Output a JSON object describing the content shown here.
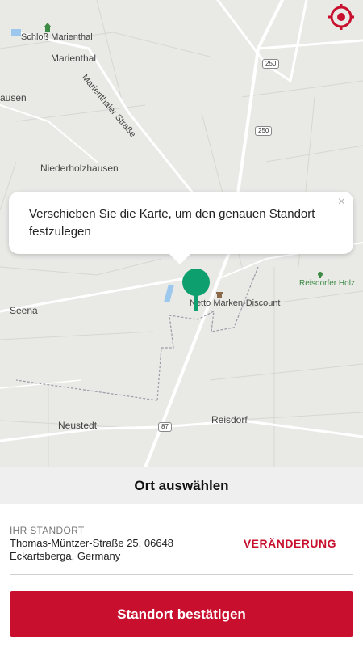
{
  "map": {
    "labels": {
      "schloss": "Schloß Marienthal",
      "marienthal": "Marienthal",
      "marienthaler_strasse": "Marienthaler Straße",
      "hausen": "ausen",
      "niederholzhausen": "Niederholzhausen",
      "reisdorfer_holz": "Reisdorfer Holz",
      "netto": "Netto Marken-Discount",
      "seena": "Seena",
      "neustedt": "Neustedt",
      "reisdorf": "Reisdorf"
    },
    "road_shields": {
      "r250_top": "250",
      "r250_mid": "250",
      "r87": "87"
    }
  },
  "tooltip": {
    "text": "Verschieben Sie die Karte, um den genauen Standort festzulegen",
    "close": "×"
  },
  "header": {
    "title": "Ort auswählen"
  },
  "location": {
    "label": "IHR STANDORT",
    "address": "Thomas-Müntzer-Straße 25, 06648 Eckartsberga, Germany",
    "change_label": "VERÄNDERUNG"
  },
  "confirm_button": "Standort bestätigen",
  "colors": {
    "accent": "#c8102e",
    "pin": "#0e9f6e",
    "map_bg": "#e9e9e6"
  },
  "icons": {
    "locate": "target-icon",
    "pin": "tree-pin-icon",
    "close": "close-icon"
  }
}
